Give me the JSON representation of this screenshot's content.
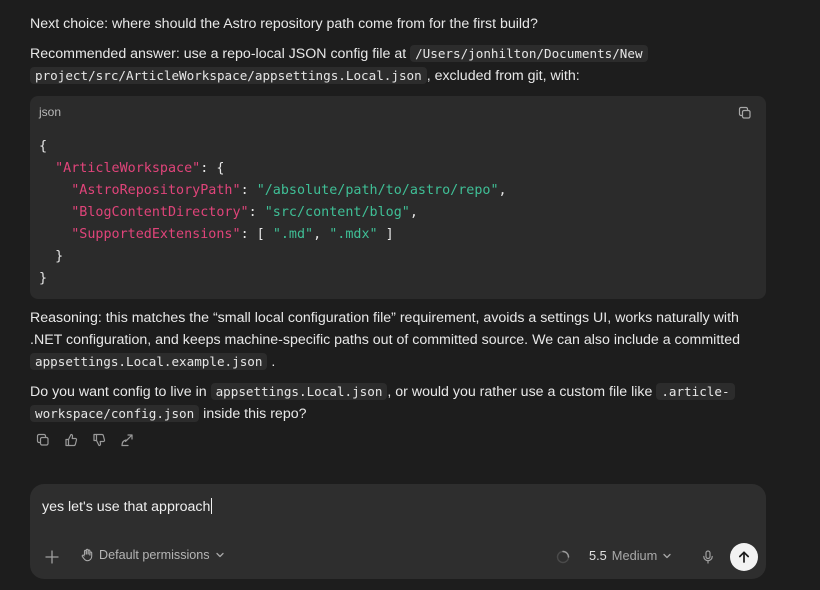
{
  "assistant": {
    "question": "Next choice: where should the Astro repository path come from for the first build?",
    "recommend_pre": "Recommended answer: use a repo-local JSON config file at ",
    "recommend_path_1": "/Users/jonhilton/Documents/New",
    "recommend_path_2": "project/src/ArticleWorkspace/appsettings.Local.json",
    "recommend_post": ", excluded from git, with:",
    "code": {
      "language": "json",
      "open_brace": "{",
      "section_key": "\"ArticleWorkspace\"",
      "lines": [
        {
          "key": "\"AstroRepositoryPath\"",
          "value": "\"/absolute/path/to/astro/repo\""
        },
        {
          "key": "\"BlogContentDirectory\"",
          "value": "\"src/content/blog\""
        },
        {
          "key": "\"SupportedExtensions\"",
          "ext1": "\".md\"",
          "ext2": "\".mdx\""
        }
      ],
      "close_inner": "}",
      "close_brace": "}"
    },
    "reasoning_1": "Reasoning: this matches the “small local configuration file” requirement, avoids a settings UI, works naturally with",
    "reasoning_2": ".NET configuration, and keeps machine-specific paths out of committed source. We can also include a committed",
    "reasoning_code": "appsettings.Local.example.json",
    "reasoning_end": ".",
    "followup_pre": "Do you want config to live in ",
    "followup_code_1": "appsettings.Local.json",
    "followup_mid": ", or would you rather use a custom file like ",
    "followup_code_2a": ".article-",
    "followup_code_2b": "workspace/config.json",
    "followup_post": " inside this repo?"
  },
  "message_actions": [
    "copy-icon",
    "thumbs-up-icon",
    "thumbs-down-icon",
    "share-icon"
  ],
  "composer": {
    "input_value": "yes let's use that approach",
    "permissions_label": "Default permissions",
    "model_version": "5.5",
    "effort_label": "Medium"
  },
  "colors": {
    "background": "#1d1d1d",
    "code_block": "#2b2b2b",
    "json_key": "#e0447a",
    "json_string": "#3fbf96",
    "composer": "#2e2e2e"
  }
}
